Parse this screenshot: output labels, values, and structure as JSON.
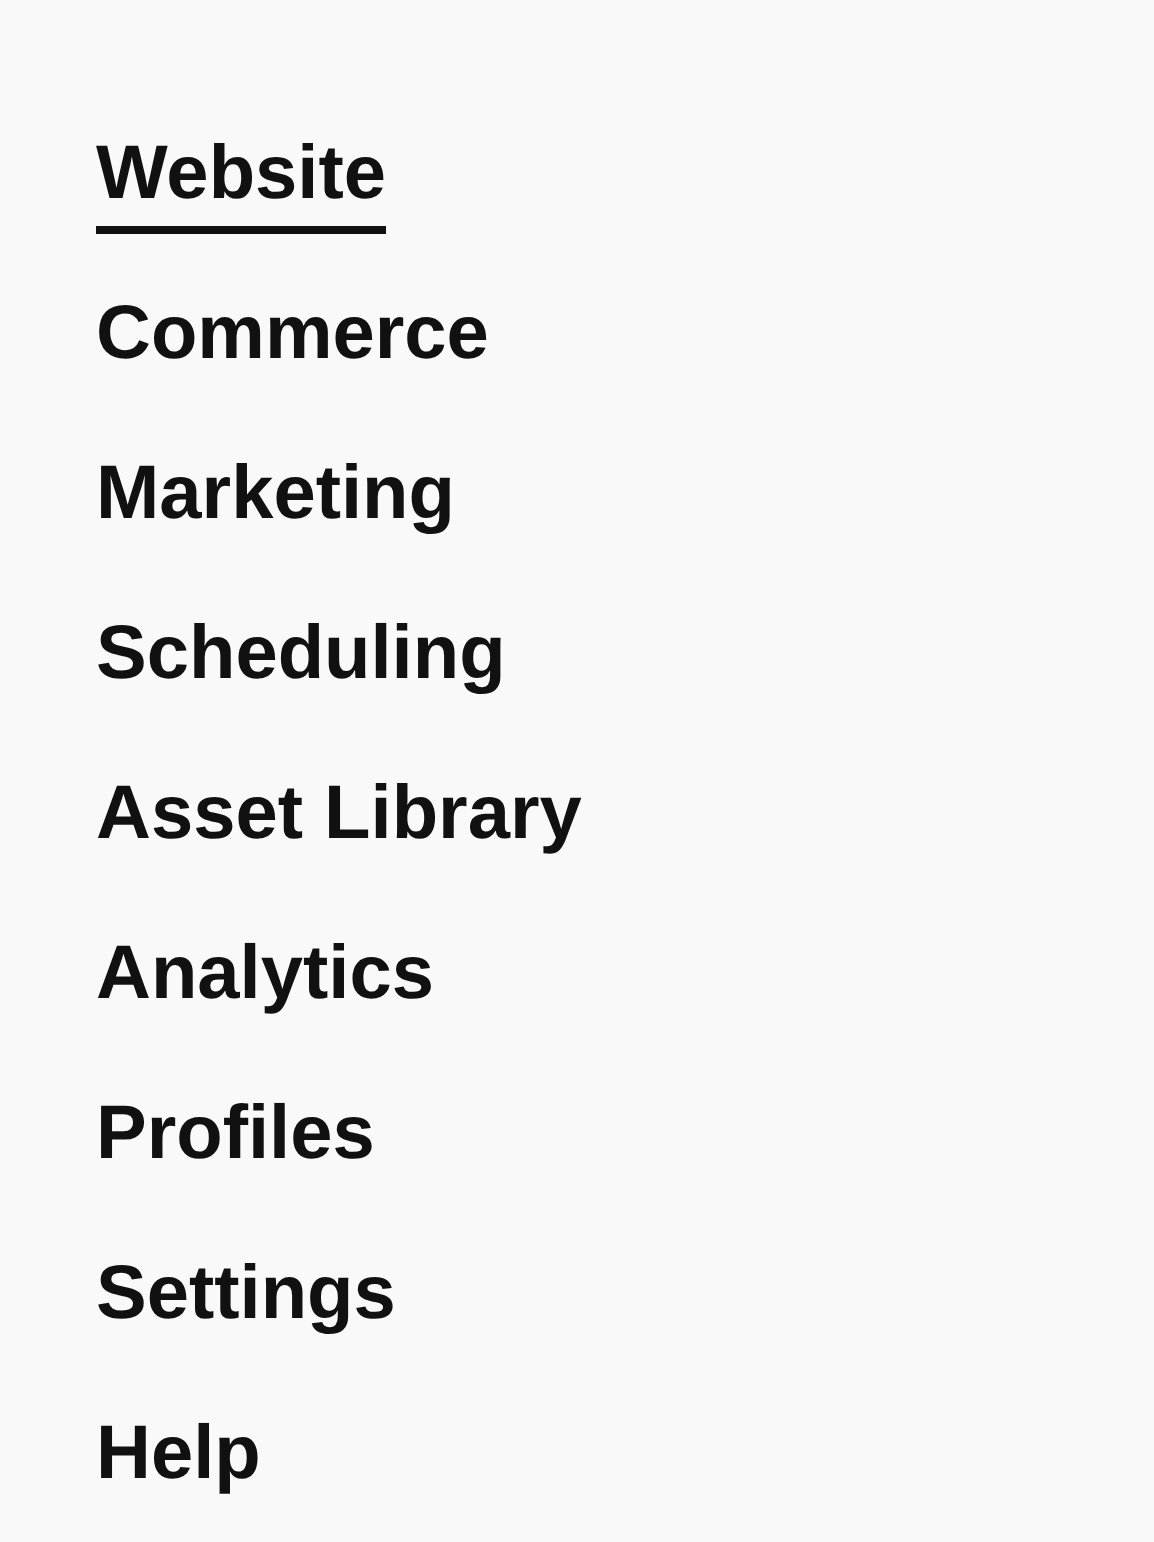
{
  "nav": {
    "items": [
      {
        "label": "Website",
        "selected": true
      },
      {
        "label": "Commerce",
        "selected": false
      },
      {
        "label": "Marketing",
        "selected": false
      },
      {
        "label": "Scheduling",
        "selected": false
      },
      {
        "label": "Asset Library",
        "selected": false
      },
      {
        "label": "Analytics",
        "selected": false
      },
      {
        "label": "Profiles",
        "selected": false
      },
      {
        "label": "Settings",
        "selected": false
      },
      {
        "label": "Help",
        "selected": false
      }
    ]
  }
}
